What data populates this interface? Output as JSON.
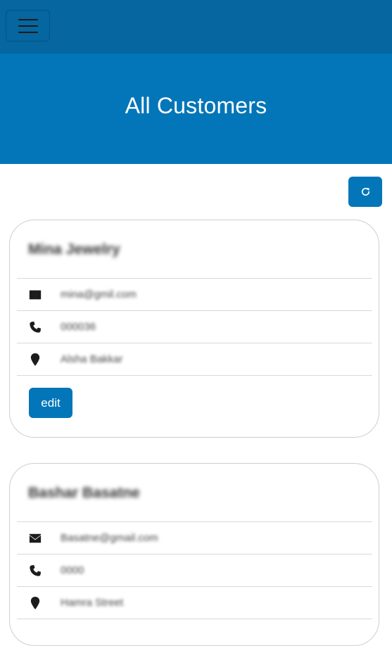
{
  "header": {
    "menu_icon": "hamburger-icon"
  },
  "page": {
    "title": "All Customers",
    "refresh_icon": "refresh-icon"
  },
  "customers": [
    {
      "name": "Mina Jewelry",
      "email": "mina@gmil.com",
      "phone": "000036",
      "address": "Alsha Bakkar",
      "edit_label": "edit"
    },
    {
      "name": "Bashar Basatne",
      "email": "Basatne@gmail.com",
      "phone": "0000",
      "address": "Hamra Street"
    }
  ],
  "colors": {
    "navbar": "#0566a0",
    "hero": "#0276b8",
    "button": "#0276b8"
  }
}
